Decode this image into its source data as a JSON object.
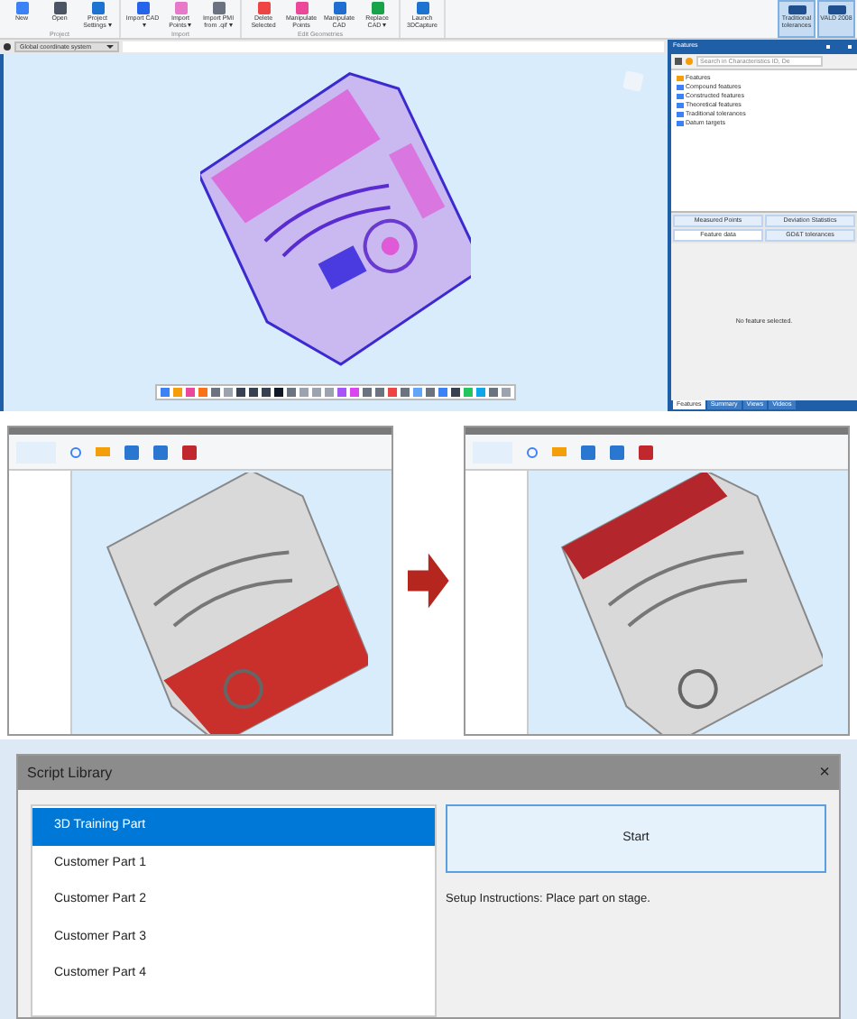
{
  "top_app": {
    "ribbon": {
      "groups": [
        {
          "label": "Project",
          "buttons": [
            {
              "label": "New",
              "menu": false
            },
            {
              "label": "Open",
              "menu": false
            },
            {
              "label": "Project Settings",
              "menu": true
            }
          ]
        },
        {
          "label": "Import",
          "buttons": [
            {
              "label": "Import CAD",
              "menu": true
            },
            {
              "label": "Import Points",
              "menu": true
            },
            {
              "label": "Import PMI from .qif",
              "menu": true
            }
          ]
        },
        {
          "label": "Edit Geometries",
          "buttons": [
            {
              "label": "Delete Selected",
              "menu": false
            },
            {
              "label": "Manipulate Points",
              "menu": false
            },
            {
              "label": "Manipulate CAD",
              "menu": false
            },
            {
              "label": "Replace CAD",
              "menu": true
            }
          ]
        },
        {
          "buttons": [
            {
              "label": "Launch 3DCapture",
              "menu": false
            }
          ]
        }
      ],
      "right_buttons": [
        {
          "label": "Traditional tolerances",
          "selected": true
        },
        {
          "label": "VALD 2008",
          "selected": true
        }
      ]
    },
    "coordinate_dropdown": {
      "value": "Global coordinate system"
    },
    "features_panel": {
      "title": "Features",
      "search": {
        "placeholder": "Search in Characteristics ID, De"
      },
      "tree": [
        "Features",
        "Compound features",
        "Constructed features",
        "Theoretical features",
        "Traditional tolerances",
        "Datum targets"
      ],
      "tabs": [
        {
          "label": "Measured Points",
          "selected": false
        },
        {
          "label": "Deviation Statistics",
          "selected": false
        },
        {
          "label": "Feature data",
          "selected": true
        },
        {
          "label": "GD&T tolerances",
          "selected": false
        }
      ],
      "empty_message": "No feature selected.",
      "bottom_tabs": [
        {
          "label": "Features",
          "selected": true
        },
        {
          "label": "Summary",
          "selected": false
        },
        {
          "label": "Views",
          "selected": false
        },
        {
          "label": "Videos",
          "selected": false
        }
      ]
    }
  },
  "script_library": {
    "title": "Script Library",
    "close": "×",
    "items": [
      {
        "label": "3D Training Part",
        "selected": true
      },
      {
        "label": "Customer Part 1",
        "selected": false
      },
      {
        "label": "Customer Part 2",
        "selected": false
      },
      {
        "label": "Customer Part 3",
        "selected": false
      },
      {
        "label": "Customer Part 4",
        "selected": false
      }
    ],
    "start_button": "Start",
    "instructions": "Setup Instructions: Place part on stage."
  }
}
